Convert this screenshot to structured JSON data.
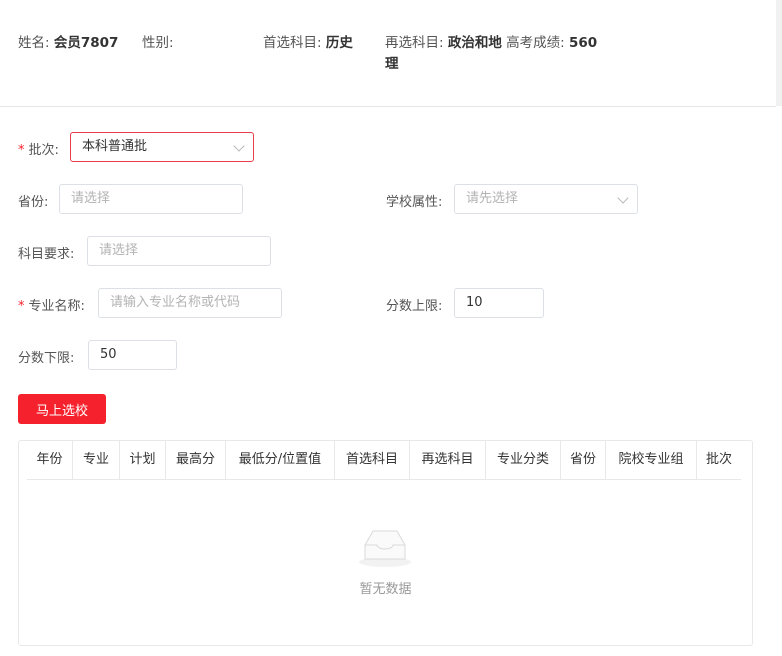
{
  "profile": {
    "name_label": "姓名:",
    "name_value": "会员7807",
    "gender_label": "性别:",
    "gender_value": "",
    "first_subject_label": "首选科目:",
    "first_subject_value": "历史",
    "second_subject_label": "再选科目:",
    "second_subject_value_line1": "政治和地",
    "second_subject_value_line2": "理",
    "score_label": "高考成绩:",
    "score_value": "560"
  },
  "form": {
    "batch_label": "批次:",
    "batch_value": "本科普通批",
    "province_label": "省份:",
    "province_placeholder": "请选择",
    "school_attr_label": "学校属性:",
    "school_attr_placeholder": "请先选择",
    "subject_req_label": "科目要求:",
    "subject_req_placeholder": "请选择",
    "major_label": "专业名称:",
    "major_placeholder": "请输入专业名称或代码",
    "score_upper_label": "分数上限:",
    "score_upper_value": "10",
    "score_lower_label": "分数下限:",
    "score_lower_value": "50",
    "submit_label": "马上选校"
  },
  "table": {
    "columns": [
      "年份",
      "专业",
      "计划",
      "最高分",
      "最低分/位置值",
      "首选科目",
      "再选科目",
      "专业分类",
      "省份",
      "院校专业组",
      "批次"
    ],
    "empty_text": "暂无数据"
  },
  "colors": {
    "accent": "#f5222d",
    "border": "#dcdfe6"
  }
}
